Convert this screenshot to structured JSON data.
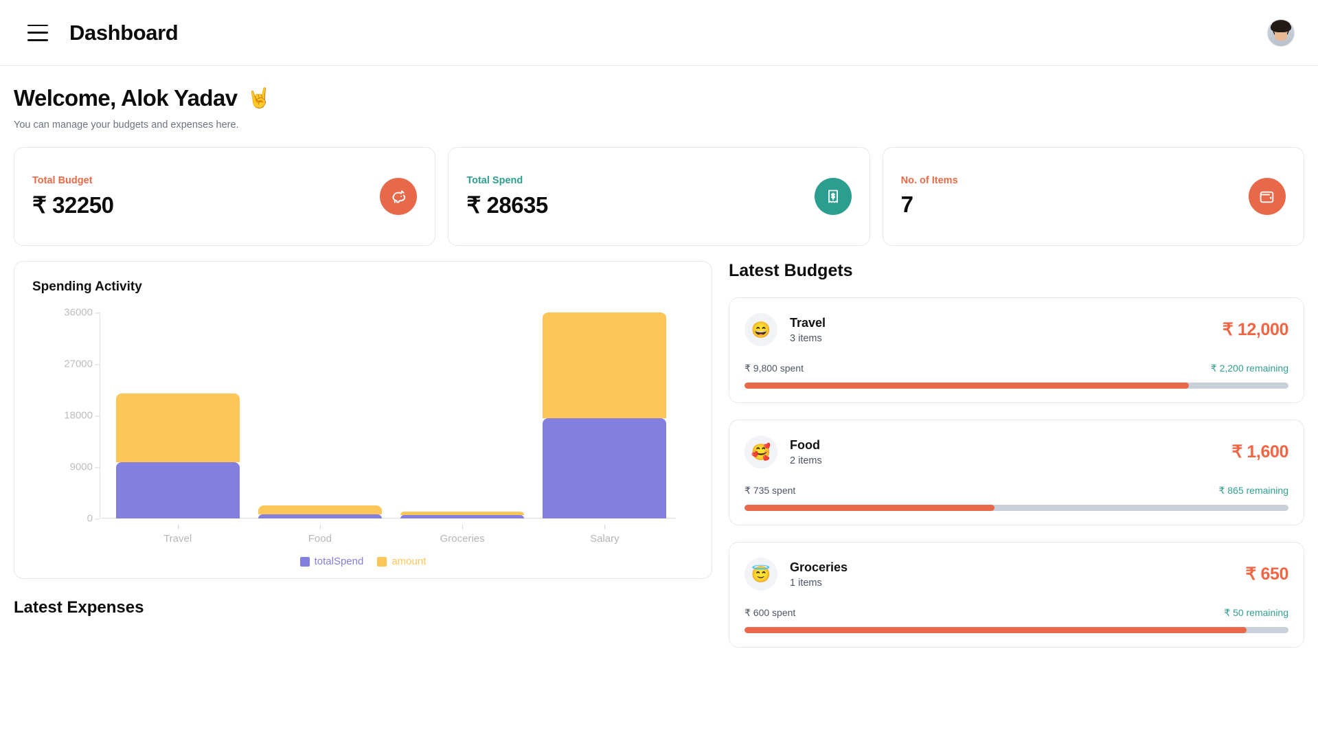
{
  "header": {
    "menu_icon": "hamburger-icon",
    "title": "Dashboard",
    "avatar_icon": "user-avatar"
  },
  "welcome": {
    "greeting": "Welcome, Alok Yadav",
    "emoji": "🤘",
    "subtitle": "You can manage your budgets and expenses here."
  },
  "stats": [
    {
      "label": "Total Budget",
      "value": "₹ 32250",
      "icon": "piggy-bank-icon",
      "label_color": "#ea6a47",
      "icon_bg": "#e8694a"
    },
    {
      "label": "Total Spend",
      "value": "₹ 28635",
      "icon": "receipt-dollar-icon",
      "label_color": "#2e9e91",
      "icon_bg": "#2b9e90"
    },
    {
      "label": "No. of Items",
      "value": "7",
      "icon": "wallet-icon",
      "label_color": "#ea6a47",
      "icon_bg": "#e8694a"
    }
  ],
  "chart_panel": {
    "title": "Spending Activity"
  },
  "chart_data": {
    "type": "bar",
    "stacked": true,
    "title": "Spending Activity",
    "xlabel": "",
    "ylabel": "",
    "ylim": [
      0,
      36000
    ],
    "yticks": [
      0,
      9000,
      18000,
      27000,
      36000
    ],
    "grid": false,
    "legend_position": "bottom",
    "categories": [
      "Travel",
      "Food",
      "Groceries",
      "Salary"
    ],
    "series": [
      {
        "name": "totalSpend",
        "color": "#837fdd",
        "values": [
          9800,
          735,
          600,
          17500
        ]
      },
      {
        "name": "amount",
        "color": "#fdc659",
        "values": [
          12000,
          1600,
          650,
          18500
        ]
      }
    ]
  },
  "latest_expenses": {
    "title": "Latest Expenses"
  },
  "budgets": {
    "title": "Latest Budgets",
    "items": [
      {
        "emoji": "😄",
        "name": "Travel",
        "items_count": "3 items",
        "amount": "₹ 12,000",
        "spent": "₹ 9,800 spent",
        "remaining": "₹ 2,200 remaining",
        "progress_percent": 81.7
      },
      {
        "emoji": "🥰",
        "name": "Food",
        "items_count": "2 items",
        "amount": "₹ 1,600",
        "spent": "₹ 735 spent",
        "remaining": "₹ 865 remaining",
        "progress_percent": 45.9
      },
      {
        "emoji": "😇",
        "name": "Groceries",
        "items_count": "1 items",
        "amount": "₹ 650",
        "spent": "₹ 600 spent",
        "remaining": "₹ 50 remaining",
        "progress_percent": 92.3
      }
    ]
  },
  "colors": {
    "accent_orange": "#e8694a",
    "accent_teal": "#2b9e90",
    "series_spend": "#837fdd",
    "series_amount": "#fdc659",
    "progress_track": "#c9d0d9"
  }
}
